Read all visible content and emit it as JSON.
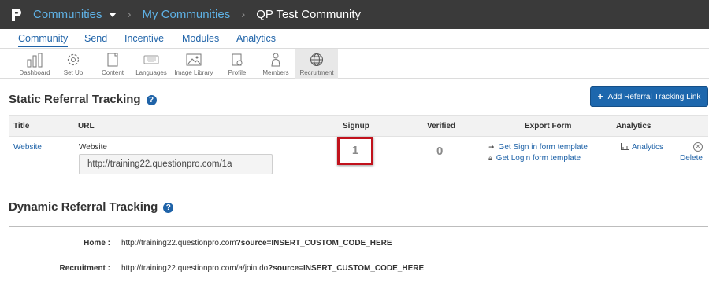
{
  "nav": {
    "communities": "Communities",
    "my_communities": "My Communities",
    "current": "QP Test Community",
    "separator": "›"
  },
  "tabs": [
    "Community",
    "Send",
    "Incentive",
    "Modules",
    "Analytics"
  ],
  "toolbar": [
    {
      "label": "Dashboard",
      "icon": "bar-chart-icon"
    },
    {
      "label": "Set Up",
      "icon": "gear-icon"
    },
    {
      "label": "Content",
      "icon": "page-icon"
    },
    {
      "label": "Languages",
      "icon": "keyboard-icon"
    },
    {
      "label": "Image Library",
      "icon": "image-icon"
    },
    {
      "label": "Profile",
      "icon": "profile-card-icon"
    },
    {
      "label": "Members",
      "icon": "person-icon"
    },
    {
      "label": "Recruitment",
      "icon": "globe-icon"
    }
  ],
  "static": {
    "title": "Static Referral Tracking",
    "help": "?",
    "add_button": "Add Referral Tracking Link",
    "add_icon": "+",
    "columns": {
      "title": "Title",
      "url": "URL",
      "signup": "Signup",
      "verified": "Verified",
      "export": "Export Form",
      "analytics": "Analytics"
    },
    "row": {
      "title": "Website",
      "url_label": "Website",
      "url": "http://training22.questionpro.com/1a",
      "signup": "1",
      "verified": "0",
      "export_signin": "Get Sign in form template",
      "export_login": "Get Login form template",
      "analytics": "Analytics",
      "delete": "Delete"
    }
  },
  "dynamic": {
    "title": "Dynamic Referral Tracking",
    "help": "?",
    "rows": [
      {
        "label": "Home :",
        "base": "http://training22.questionpro.com",
        "param": "?source=INSERT_CUSTOM_CODE_HERE"
      },
      {
        "label": "Recruitment :",
        "base": "http://training22.questionpro.com/a/join.do",
        "param": "?source=INSERT_CUSTOM_CODE_HERE"
      }
    ]
  },
  "colors": {
    "accent": "#1f63a8",
    "topbar": "#3a3a3a",
    "highlight": "#c1121c"
  }
}
